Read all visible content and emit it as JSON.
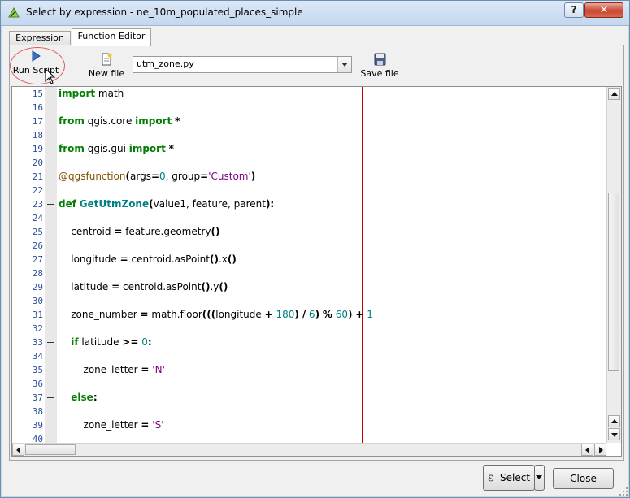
{
  "window": {
    "title": "Select by expression - ne_10m_populated_places_simple",
    "help_label": "?",
    "close_label": "✕"
  },
  "tabs": [
    {
      "label": "Expression",
      "active": false
    },
    {
      "label": "Function Editor",
      "active": true
    }
  ],
  "toolbar": {
    "run_label": "Run Script",
    "new_label": "New file",
    "save_label": "Save file",
    "file_selected": "utm_zone.py"
  },
  "editor": {
    "lines": [
      {
        "n": "15",
        "html": "<span class='kw'>import</span> math"
      },
      {
        "n": "16",
        "html": ""
      },
      {
        "n": "17",
        "html": "<span class='kw'>from</span> qgis.core <span class='kw'>import</span> <span class='op'>*</span>"
      },
      {
        "n": "18",
        "html": ""
      },
      {
        "n": "19",
        "html": "<span class='kw'>from</span> qgis.gui <span class='kw'>import</span> <span class='op'>*</span>"
      },
      {
        "n": "20",
        "html": ""
      },
      {
        "n": "21",
        "html": "<span class='deco'>@qgsfunction</span><span class='op'>(</span>args<span class='op'>=</span><span class='num'>0</span>, group<span class='op'>=</span><span class='str'>'Custom'</span><span class='op'>)</span>"
      },
      {
        "n": "22",
        "html": ""
      },
      {
        "n": "23",
        "html": "<span class='kw'>def</span> <span class='fn'>GetUtmZone</span><span class='op'>(</span>value1, feature, parent<span class='op'>):</span>",
        "fold": true
      },
      {
        "n": "24",
        "html": ""
      },
      {
        "n": "25",
        "html": "    centroid <span class='op'>=</span> feature.geometry<span class='op'>()</span>"
      },
      {
        "n": "26",
        "html": ""
      },
      {
        "n": "27",
        "html": "    longitude <span class='op'>=</span> centroid.asPoint<span class='op'>()</span>.x<span class='op'>()</span>"
      },
      {
        "n": "28",
        "html": ""
      },
      {
        "n": "29",
        "html": "    latitude <span class='op'>=</span> centroid.asPoint<span class='op'>()</span>.y<span class='op'>()</span>"
      },
      {
        "n": "30",
        "html": ""
      },
      {
        "n": "31",
        "html": "    zone_number <span class='op'>=</span> math.floor<span class='op'>(((</span>longitude <span class='op'>+</span> <span class='num'>180</span><span class='op'>)</span> <span class='op'>/</span> <span class='num'>6</span><span class='op'>)</span> <span class='op'>%</span> <span class='num'>60</span><span class='op'>)</span> <span class='op'>+</span> <span class='num'>1</span>"
      },
      {
        "n": "32",
        "html": ""
      },
      {
        "n": "33",
        "html": "    <span class='kw'>if</span> latitude <span class='op'>&gt;=</span> <span class='num'>0</span><span class='op'>:</span>",
        "fold": true
      },
      {
        "n": "34",
        "html": ""
      },
      {
        "n": "35",
        "html": "        zone_letter <span class='op'>=</span> <span class='str'>'N'</span>"
      },
      {
        "n": "36",
        "html": ""
      },
      {
        "n": "37",
        "html": "    <span class='kw'>else</span><span class='op'>:</span>",
        "fold": true
      },
      {
        "n": "38",
        "html": ""
      },
      {
        "n": "39",
        "html": "        zone_letter <span class='op'>=</span> <span class='str'>'S'</span>"
      },
      {
        "n": "40",
        "html": ""
      }
    ]
  },
  "footer": {
    "select_label": "Select",
    "close_label": "Close"
  },
  "colors": {
    "keyword": "#008000",
    "function_name": "#00807f",
    "number": "#007f7f",
    "string": "#7f007f",
    "decorator": "#805000",
    "edge_line": "#c00000",
    "highlight_circle": "#e25c5c"
  }
}
